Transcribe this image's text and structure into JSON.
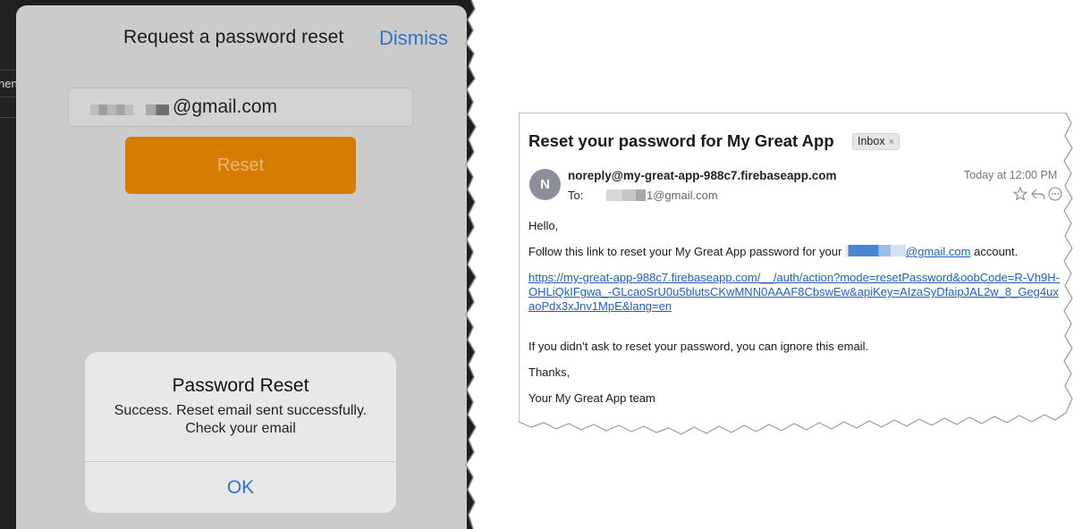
{
  "phone": {
    "background_app_text": "nen",
    "sheet_title": "Request a password reset",
    "dismiss_label": "Dismiss",
    "email_value": "@gmail.com",
    "reset_label": "Reset",
    "alert": {
      "title": "Password Reset",
      "message": "Success. Reset email sent successfully.  Check your email",
      "ok_label": "OK"
    },
    "colors": {
      "accent": "#2f74c6",
      "reset_button": "#d67c00"
    }
  },
  "email": {
    "subject": "Reset your password for My Great App",
    "mailbox_badge": "Inbox",
    "badge_close": "×",
    "avatar_initial": "N",
    "sender": "noreply@my-great-app-988c7.firebaseapp.com",
    "to_label": "To:",
    "to_value": "1@gmail.com",
    "timestamp": "Today at 12:00 PM",
    "greeting": "Hello,",
    "instruction_prefix": "Follow this link to reset your My Great App password for your",
    "instruction_email": "@gmail.com",
    "instruction_suffix": "account.",
    "reset_link": "https://my-great-app-988c7.firebaseapp.com/__/auth/action?mode=resetPassword&oobCode=R-Vh9H-OHLiQkIFgwa_-GLcaoSrU0u5blutsCKwMNN0AAAF8CbswEw&apiKey=AIzaSyDfaipJAL2w_8_Geg4uxaoPdx3xJnv1MpE&lang=en",
    "ignore_text": "If you didn’t ask to reset your password, you can ignore this email.",
    "thanks_text": "Thanks,",
    "signature_text": "Your My Great App team",
    "icons": [
      "star-icon",
      "reply-icon",
      "more-icon"
    ],
    "colors": {
      "link": "#1f5fc4",
      "avatar": "#8b8f99"
    }
  }
}
